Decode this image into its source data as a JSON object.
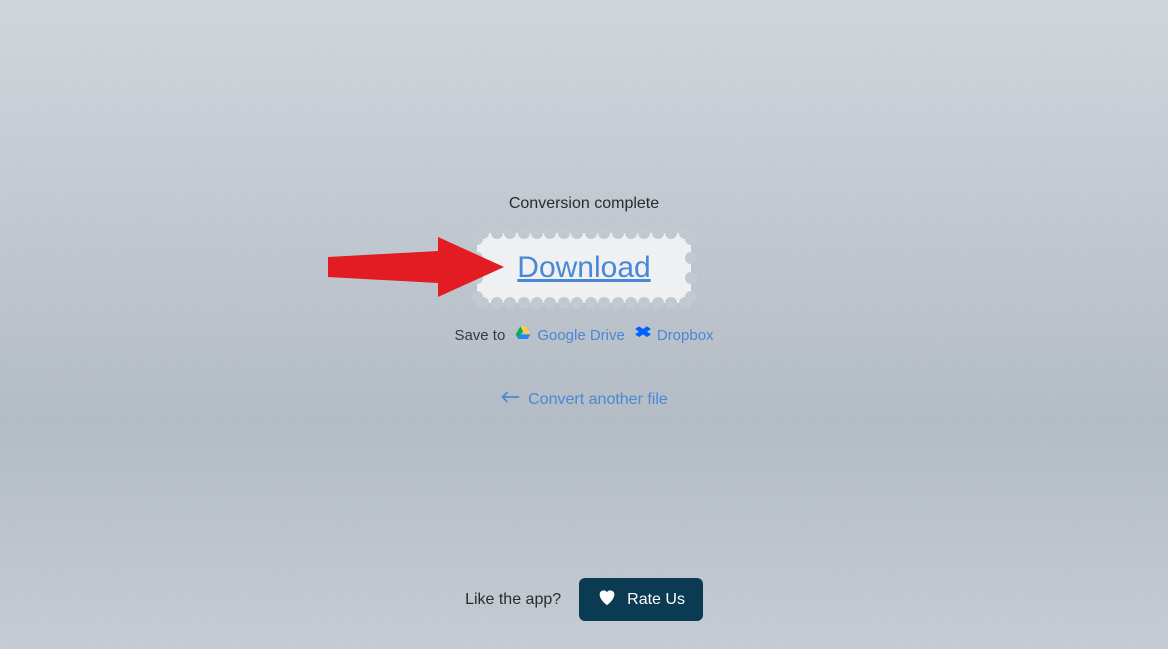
{
  "status_text": "Conversion complete",
  "download_label": "Download",
  "save_to_label": "Save to",
  "providers": {
    "gdrive_label": "Google Drive",
    "dropbox_label": "Dropbox"
  },
  "convert_again_label": "Convert another file",
  "footer": {
    "like_text": "Like the app?",
    "rate_label": "Rate Us"
  },
  "colors": {
    "link": "#4a87d6",
    "rate_bg": "#0a3b52",
    "annotation": "#e31b23"
  }
}
